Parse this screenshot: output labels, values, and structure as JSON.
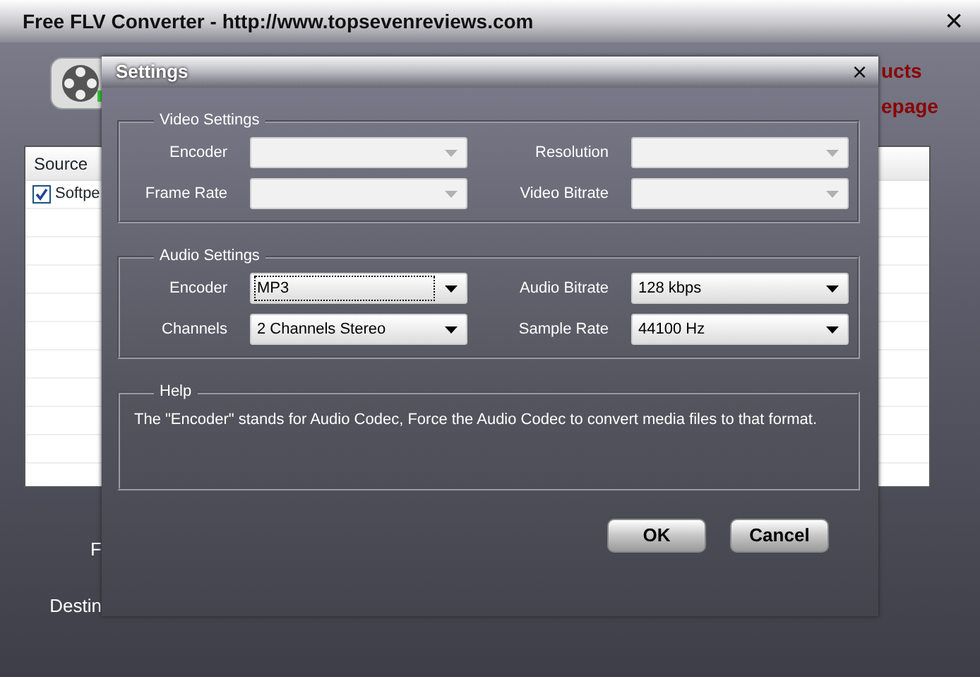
{
  "window": {
    "title": "Free FLV Converter - http://www.topsevenreviews.com",
    "close": "×"
  },
  "background": {
    "links": [
      "ucts",
      "epage"
    ],
    "table": {
      "columns": [
        "Source"
      ],
      "rows": [
        {
          "checked": true,
          "text": "Softpe"
        }
      ]
    },
    "labels": [
      "F",
      "Destin"
    ]
  },
  "dialog": {
    "title": "Settings",
    "close": "×",
    "groups": [
      {
        "title": "Video Settings",
        "fields": [
          {
            "label": "Encoder",
            "disabled": true,
            "focused": false
          },
          {
            "label": "Resolution",
            "disabled": true,
            "focused": false
          },
          {
            "label": "Frame Rate",
            "disabled": true,
            "focused": false
          },
          {
            "label": "Video Bitrate",
            "disabled": true,
            "focused": false
          }
        ]
      },
      {
        "title": "Audio Settings",
        "fields": [
          {
            "label": "Encoder",
            "value": "MP3",
            "disabled": false,
            "focused": true
          },
          {
            "label": "Audio Bitrate",
            "value": "128 kbps",
            "disabled": false,
            "focused": false
          },
          {
            "label": "Channels",
            "value": "2 Channels Stereo",
            "disabled": false,
            "focused": false
          },
          {
            "label": "Sample Rate",
            "value": "44100 Hz",
            "disabled": false,
            "focused": false
          }
        ]
      }
    ],
    "help": {
      "title": "Help",
      "text": "The \"Encoder\" stands for Audio Codec, Force the Audio Codec to convert media files to that format."
    },
    "buttons": [
      "OK",
      "Cancel"
    ]
  }
}
